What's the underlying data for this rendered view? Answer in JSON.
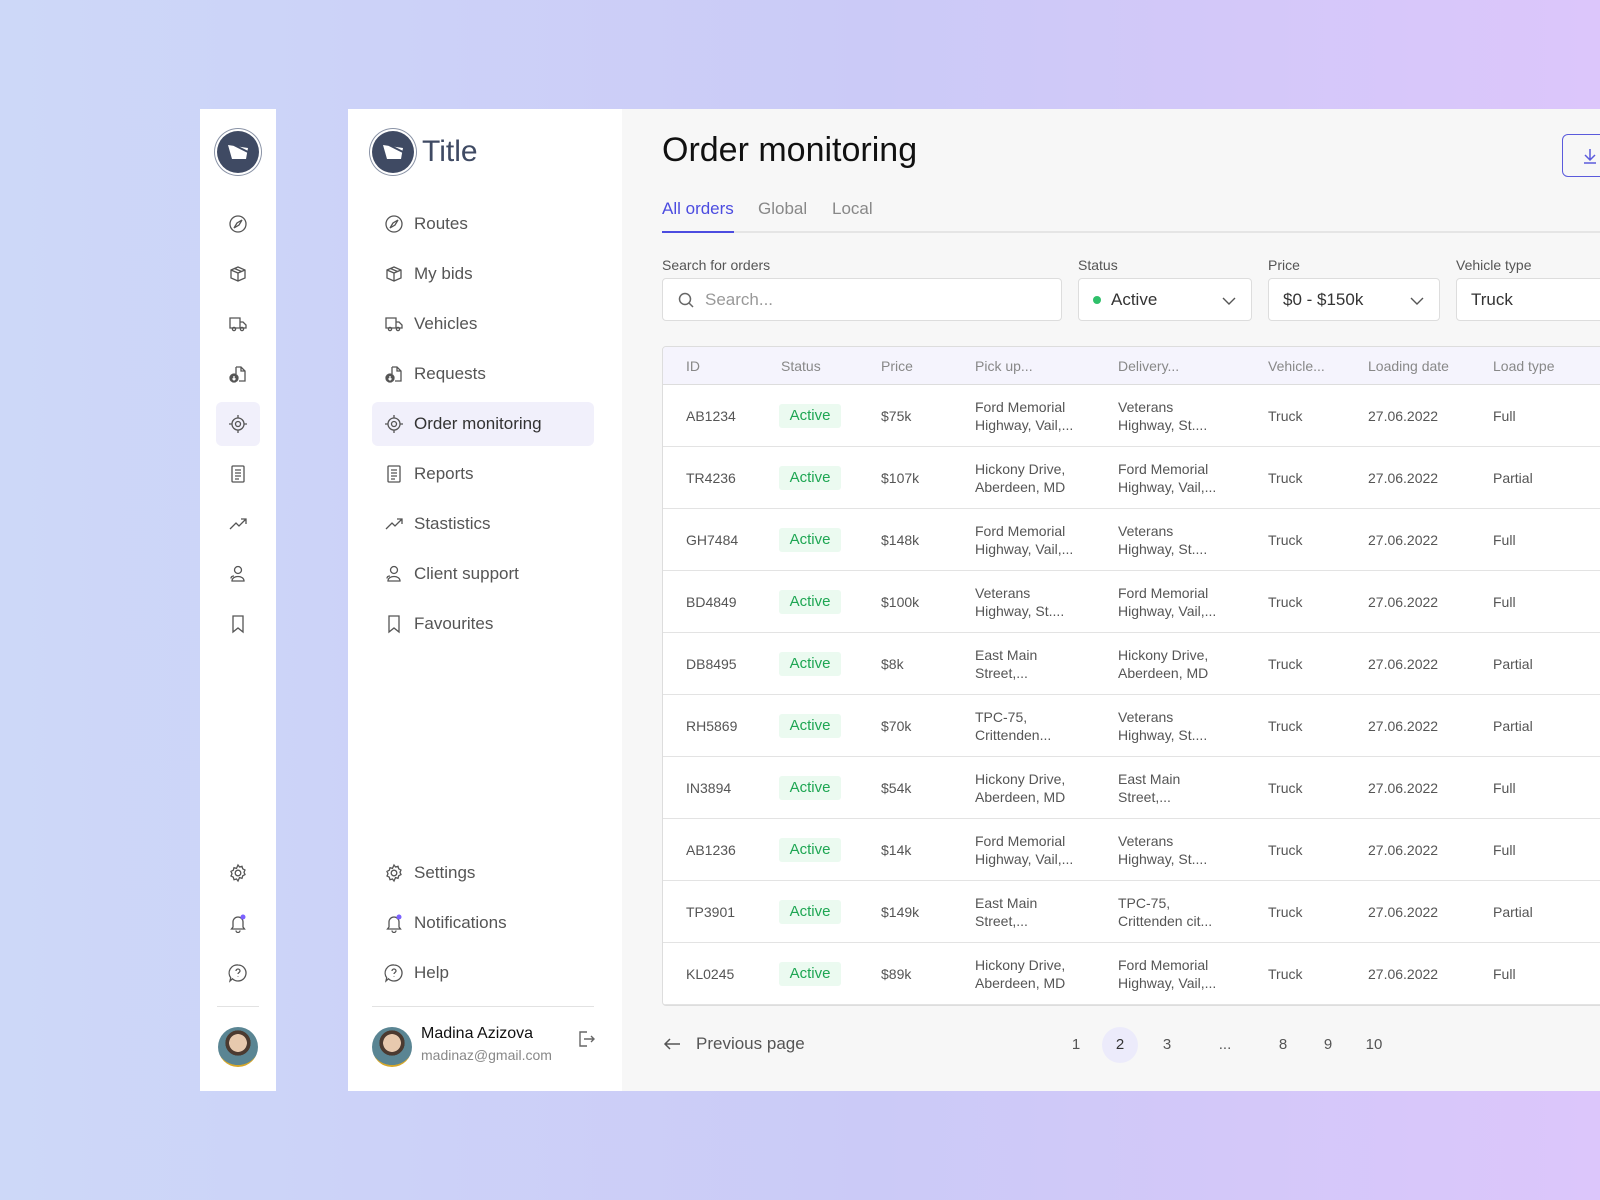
{
  "sidebar": {
    "title": "Title",
    "items": [
      {
        "label": "Routes",
        "icon": "compass-icon"
      },
      {
        "label": "My bids",
        "icon": "box-icon"
      },
      {
        "label": "Vehicles",
        "icon": "truck-icon"
      },
      {
        "label": "Requests",
        "icon": "file-download-icon"
      },
      {
        "label": "Order monitoring",
        "icon": "target-icon",
        "active": true
      },
      {
        "label": "Reports",
        "icon": "document-icon"
      },
      {
        "label": "Stastistics",
        "icon": "trend-icon"
      },
      {
        "label": "Client support",
        "icon": "support-icon"
      },
      {
        "label": "Favourites",
        "icon": "bookmark-icon"
      }
    ],
    "bottom": [
      {
        "label": "Settings",
        "icon": "gear-icon"
      },
      {
        "label": "Notifications",
        "icon": "bell-icon"
      },
      {
        "label": "Help",
        "icon": "help-icon"
      }
    ],
    "user": {
      "name": "Madina Azizova",
      "email": "madinaz@gmail.com"
    }
  },
  "main": {
    "title": "Order monitoring",
    "tabs": [
      "All orders",
      "Global",
      "Local"
    ],
    "filters": {
      "search_label": "Search for orders",
      "search_placeholder": "Search...",
      "status_label": "Status",
      "status_value": "Active",
      "price_label": "Price",
      "price_value": "$0 - $150k",
      "vehicle_label": "Vehicle type",
      "vehicle_value": "Truck"
    },
    "table": {
      "columns": [
        "ID",
        "Status",
        "Price",
        "Pick up...",
        "Delivery...",
        "Vehicle...",
        "Loading date",
        "Load type"
      ],
      "rows": [
        [
          "AB1234",
          "Active",
          "$75k",
          "Ford Memorial\nHighway, Vail,...",
          "Veterans\nHighway, St....",
          "Truck",
          "27.06.2022",
          "Full"
        ],
        [
          "TR4236",
          "Active",
          "$107k",
          "Hickony Drive,\nAberdeen, MD",
          "Ford Memorial\nHighway, Vail,...",
          "Truck",
          "27.06.2022",
          "Partial"
        ],
        [
          "GH7484",
          "Active",
          "$148k",
          "Ford Memorial\nHighway, Vail,...",
          "Veterans\nHighway, St....",
          "Truck",
          "27.06.2022",
          "Full"
        ],
        [
          "BD4849",
          "Active",
          "$100k",
          "Veterans\nHighway, St....",
          "Ford Memorial\nHighway, Vail,...",
          "Truck",
          "27.06.2022",
          "Full"
        ],
        [
          "DB8495",
          "Active",
          "$8k",
          "East Main\nStreet,...",
          "Hickony Drive,\nAberdeen, MD",
          "Truck",
          "27.06.2022",
          "Partial"
        ],
        [
          "RH5869",
          "Active",
          "$70k",
          "TPC-75,\nCrittenden...",
          "Veterans\nHighway, St....",
          "Truck",
          "27.06.2022",
          "Partial"
        ],
        [
          "IN3894",
          "Active",
          "$54k",
          "Hickony Drive,\nAberdeen, MD",
          "East Main\nStreet,...",
          "Truck",
          "27.06.2022",
          "Full"
        ],
        [
          "AB1236",
          "Active",
          "$14k",
          "Ford Memorial\nHighway, Vail,...",
          "Veterans\nHighway, St....",
          "Truck",
          "27.06.2022",
          "Full"
        ],
        [
          "TP3901",
          "Active",
          "$149k",
          "East Main\nStreet,...",
          "TPC-75,\nCrittenden cit...",
          "Truck",
          "27.06.2022",
          "Partial"
        ],
        [
          "KL0245",
          "Active",
          "$89k",
          "Hickony Drive,\nAberdeen, MD",
          "Ford Memorial\nHighway, Vail,...",
          "Truck",
          "27.06.2022",
          "Full"
        ]
      ]
    },
    "pagination": {
      "previous": "Previous page",
      "pages": [
        "1",
        "2",
        "3",
        "...",
        "8",
        "9",
        "10"
      ],
      "current": "2"
    }
  },
  "colors": {
    "accent": "#4c4ce0",
    "active_green": "#1ea653",
    "logo": "#3f4a63"
  }
}
